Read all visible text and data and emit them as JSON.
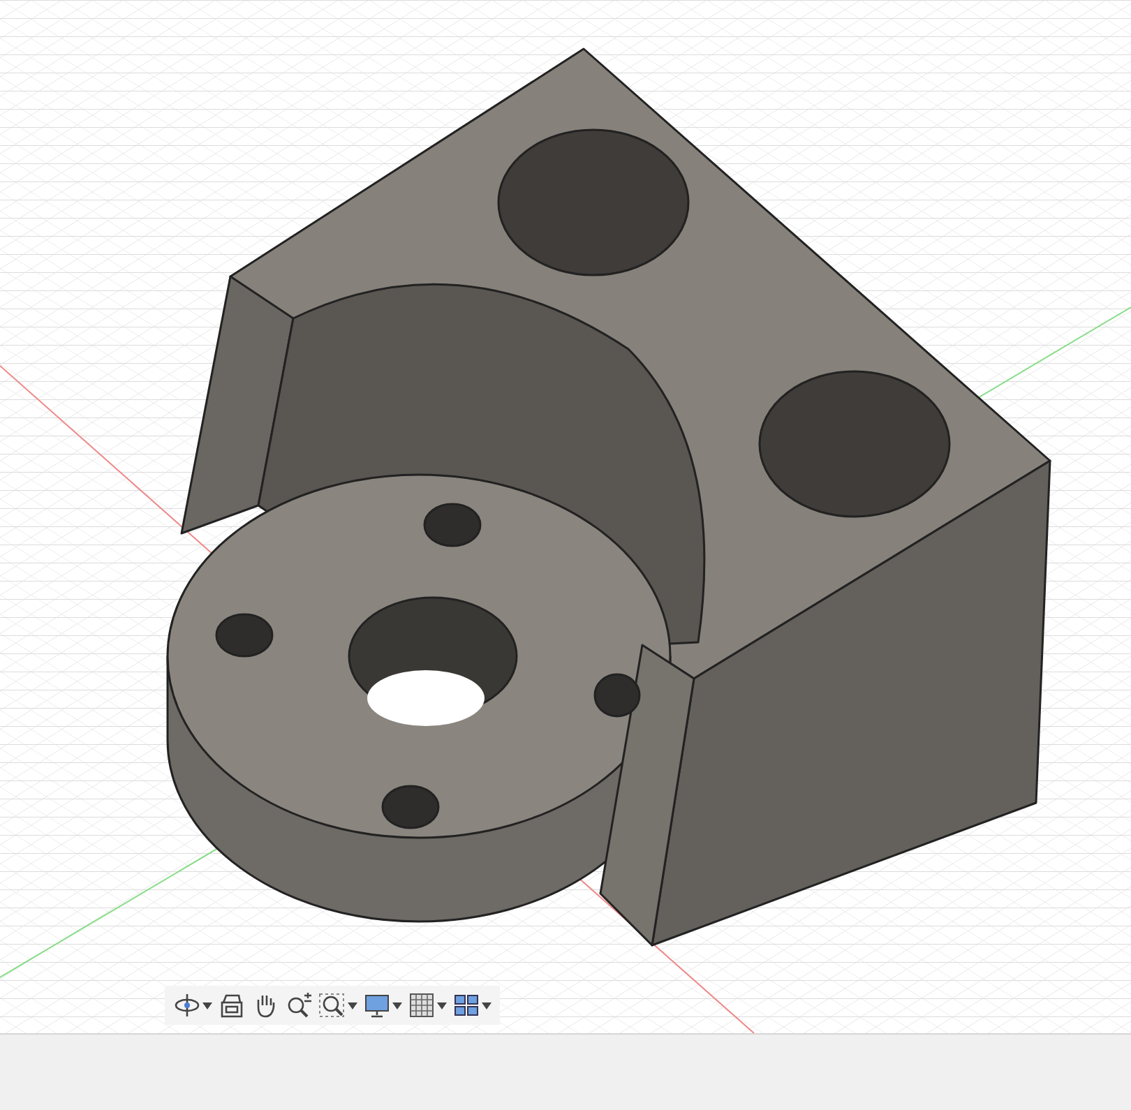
{
  "toolbar": {
    "tools": [
      {
        "kind": "orbit",
        "dropdown": true
      },
      {
        "kind": "look",
        "dropdown": false
      },
      {
        "kind": "pan",
        "dropdown": false
      },
      {
        "kind": "zoom",
        "dropdown": false
      },
      {
        "kind": "fit",
        "dropdown": true
      },
      {
        "kind": "display",
        "dropdown": true
      },
      {
        "kind": "grid",
        "dropdown": true
      },
      {
        "kind": "viewports",
        "dropdown": true
      }
    ]
  }
}
